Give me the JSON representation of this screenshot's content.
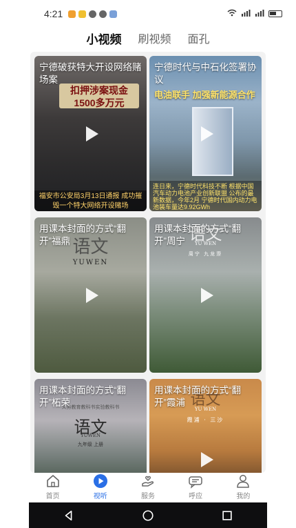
{
  "status_bar": {
    "time": "4:21"
  },
  "tabs": [
    {
      "label": "小视频",
      "active": true
    },
    {
      "label": "刷视频",
      "active": false
    },
    {
      "label": "面孔",
      "active": false
    }
  ],
  "cards": [
    {
      "title": "宁德破获特大开设网络赌场案",
      "banner_line1": "扣押涉案现金",
      "banner_line2": "1500多万元",
      "footer": "福安市公安局3月13日通报 成功摧毁一个特大网络开设赌场"
    },
    {
      "title": "宁德时代与中石化签署协议",
      "subtitle": "电油联手 加强新能源合作",
      "footer": "连日来，宁德时代科技不断 根据中国汽车动力电池产业创新联盟 公布的最新数据，今年2月 宁德时代国内动力电池装车量达9.92GWh"
    },
    {
      "title": "用课本封面的方式“翻开”福鼎",
      "cover_title": "语文",
      "cover_en": "YUWEN"
    },
    {
      "title": "用课本封面的方式“翻开”周宁",
      "cover_title": "语文",
      "cover_en": "YU WEN",
      "cover_caption": "周宁 九龙漈"
    },
    {
      "title": "用课本封面的方式“翻开”柘荣",
      "cover_top": "义务教育教科书实验教科书",
      "cover_title": "语文",
      "cover_en": "YUWEN",
      "cover_grade": "九年级 上册"
    },
    {
      "title": "用课本封面的方式“翻开”霞浦",
      "cover_title": "语文",
      "cover_en": "YU WEN",
      "cover_caption": "霞浦 · 三沙"
    }
  ],
  "bottom_nav": [
    {
      "label": "首页",
      "icon": "home-icon",
      "active": false
    },
    {
      "label": "视听",
      "icon": "play-circle-icon",
      "active": true
    },
    {
      "label": "服务",
      "icon": "hand-service-icon",
      "active": false
    },
    {
      "label": "呼应",
      "icon": "respond-icon",
      "active": false
    },
    {
      "label": "我的",
      "icon": "user-icon",
      "active": false
    }
  ],
  "colors": {
    "accent": "#2a6fe6"
  }
}
